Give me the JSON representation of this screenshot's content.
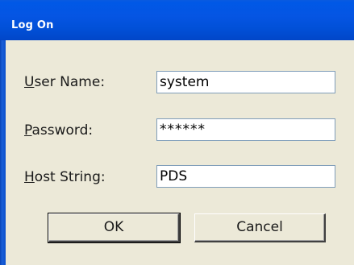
{
  "window": {
    "title": "Log On"
  },
  "form": {
    "user_name_label_first": "U",
    "user_name_label_rest": "ser Name:",
    "user_name_value": "system",
    "password_label_first": "P",
    "password_label_rest": "assword:",
    "password_value": "******",
    "host_label_first": "H",
    "host_label_rest": "ost String:",
    "host_value": "PDS"
  },
  "buttons": {
    "ok_label": "OK",
    "cancel_label": "Cancel"
  },
  "colors": {
    "titlebar": "#0055e5",
    "dialog_bg": "#ece9d8"
  }
}
